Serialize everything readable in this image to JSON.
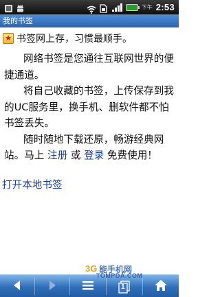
{
  "status_bar": {
    "ampm": "下午",
    "time": "2:53",
    "icons": [
      "notification-icon",
      "android-icon",
      "wifi-icon",
      "sim-icon",
      "signal-icon",
      "battery-icon"
    ]
  },
  "title_bar": {
    "title": "我的书签"
  },
  "main": {
    "slogan": "书签网上存，习惯最顺手。",
    "paragraph1": "网络书签是您通往互联网世界的便捷通道。",
    "paragraph2": "将自己收藏的书签，上传保存到我的UC服务里，换手机、删软件都不怕书签丢失。",
    "paragraph3_prefix": "随时随地下载还原，畅游经典网站。马上 ",
    "register_link": "注册",
    "or_text": " 或 ",
    "login_link": "登录",
    "paragraph3_suffix": " 免费使用！",
    "local_bookmarks_link": "打开本地书签"
  },
  "watermark": {
    "logo": "3G",
    "cn": "能手机网",
    "en": "TOMPDA.COM"
  },
  "toolbar": {
    "page_number": "1",
    "icons": [
      "back-arrow-icon",
      "forward-arrow-icon",
      "menu-icon",
      "window-count-icon",
      "home-icon"
    ]
  },
  "colors": {
    "title_bar": "#3c7bc6",
    "link": "#1a3fa6",
    "toolbar": "#2f6fba"
  }
}
